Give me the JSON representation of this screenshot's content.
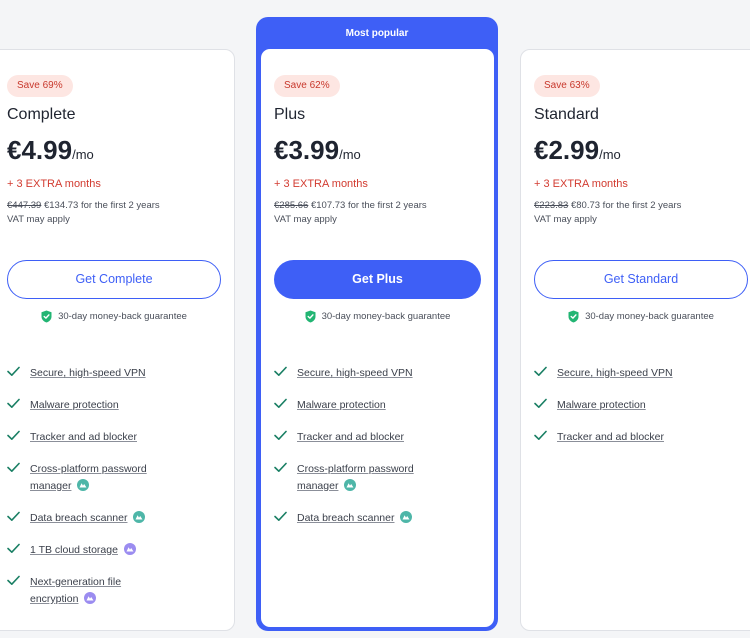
{
  "popular_label": "Most popular",
  "plans": {
    "complete": {
      "save": "Save 69%",
      "name": "Complete",
      "price": "€4.99",
      "per": "/mo",
      "extra": "+ 3 EXTRA months",
      "old_price": "€447.39",
      "new_price": "€134.73",
      "billing_suffix": " for the first 2 years",
      "vat": "VAT may apply",
      "cta": "Get Complete",
      "guarantee": "30-day money-back guarantee",
      "features": [
        {
          "l1": "Secure, high-speed VPN",
          "l2": "",
          "icon": ""
        },
        {
          "l1": "Malware protection",
          "l2": "",
          "icon": ""
        },
        {
          "l1": "Tracker and ad blocker",
          "l2": "",
          "icon": ""
        },
        {
          "l1": "Cross-platform password",
          "l2": "manager",
          "icon": "teal"
        },
        {
          "l1": "Data breach scanner",
          "l2": "",
          "icon": "teal"
        },
        {
          "l1": "1 TB cloud storage",
          "l2": "",
          "icon": "purple"
        },
        {
          "l1": "Next-generation file",
          "l2": "encryption",
          "icon": "purple"
        }
      ]
    },
    "plus": {
      "save": "Save 62%",
      "name": "Plus",
      "price": "€3.99",
      "per": "/mo",
      "extra": "+ 3 EXTRA months",
      "old_price": "€285.66",
      "new_price": "€107.73",
      "billing_suffix": " for the first 2 years",
      "vat": "VAT may apply",
      "cta": "Get Plus",
      "guarantee": "30-day money-back guarantee",
      "features": [
        {
          "l1": "Secure, high-speed VPN",
          "l2": "",
          "icon": ""
        },
        {
          "l1": "Malware protection",
          "l2": "",
          "icon": ""
        },
        {
          "l1": "Tracker and ad blocker",
          "l2": "",
          "icon": ""
        },
        {
          "l1": "Cross-platform password",
          "l2": "manager",
          "icon": "teal"
        },
        {
          "l1": "Data breach scanner",
          "l2": "",
          "icon": "teal"
        }
      ]
    },
    "standard": {
      "save": "Save 63%",
      "name": "Standard",
      "price": "€2.99",
      "per": "/mo",
      "extra": "+ 3 EXTRA months",
      "old_price": "€223.83",
      "new_price": "€80.73",
      "billing_suffix": " for the first 2 years",
      "vat": "VAT may apply",
      "cta": "Get Standard",
      "guarantee": "30-day money-back guarantee",
      "features": [
        {
          "l1": "Secure, high-speed VPN",
          "l2": "",
          "icon": ""
        },
        {
          "l1": "Malware protection",
          "l2": "",
          "icon": ""
        },
        {
          "l1": "Tracker and ad blocker",
          "l2": "",
          "icon": ""
        }
      ]
    }
  },
  "colors": {
    "accent": "#3e5ff6",
    "save_bg": "#fde6e2",
    "save_text": "#c8382c",
    "extra_text": "#d23b30",
    "check": "#1a7f64",
    "shield": "#22b573",
    "feature_teal": "#4eb6a8",
    "feature_purple": "#9b8cf0"
  },
  "icons": {
    "check": "check-icon",
    "shield": "shield-check-icon",
    "teal_badge": "product-badge-teal-icon",
    "purple_badge": "product-badge-purple-icon"
  }
}
